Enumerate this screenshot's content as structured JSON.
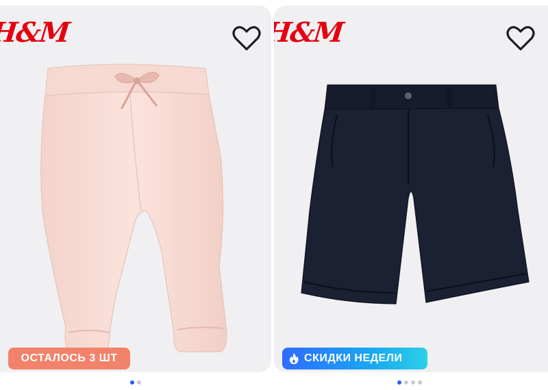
{
  "products": [
    {
      "brand": "H&M",
      "badge": "ОСТАЛОСЬ 3 ШТ",
      "badge_color": "#f2826a",
      "favorite_icon": "heart-outline-icon",
      "carousel_pages": 2,
      "carousel_active": 1
    },
    {
      "brand": "H&M",
      "badge": "СКИДКИ НЕДЕЛИ",
      "badge_icon": "fire-icon",
      "badge_color": "#1e88ff",
      "favorite_icon": "heart-outline-icon",
      "carousel_pages": 4,
      "carousel_active": 1
    }
  ],
  "colors": {
    "brand_red": "#e50010",
    "accent_blue": "#2a5cff",
    "photo_bg": "#f0f0f2"
  }
}
